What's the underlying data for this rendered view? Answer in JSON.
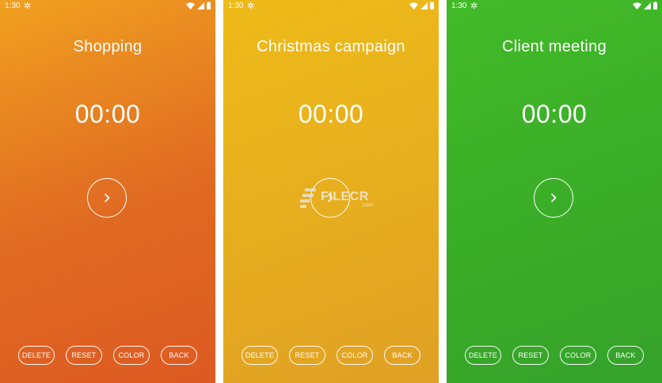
{
  "screens": [
    {
      "name": "orange",
      "gradient": [
        "#f0a020",
        "#e06a22",
        "#dd5a22"
      ],
      "status_time": "1:30",
      "title": "Shopping",
      "timer": "00:00",
      "buttons": {
        "delete": "DELETE",
        "reset": "RESET",
        "color": "COLOR",
        "back": "BACK"
      }
    },
    {
      "name": "yellow",
      "gradient": [
        "#eebb18",
        "#e6ad1f",
        "#e0a025"
      ],
      "status_time": "1:30",
      "title": "Christmas campaign",
      "timer": "00:00",
      "buttons": {
        "delete": "DELETE",
        "reset": "RESET",
        "color": "COLOR",
        "back": "BACK"
      }
    },
    {
      "name": "green",
      "gradient": [
        "#42ba28",
        "#3aad28",
        "#35a22a"
      ],
      "status_time": "1:30",
      "title": "Client meeting",
      "timer": "00:00",
      "buttons": {
        "delete": "DELETE",
        "reset": "RESET",
        "color": "COLOR",
        "back": "BACK"
      }
    }
  ],
  "watermark": {
    "text": "FILECR",
    "suffix": ".com"
  },
  "icons": {
    "status_gear": "gear-icon",
    "status_wifi": "wifi-icon",
    "status_signal": "signal-icon",
    "status_battery": "battery-icon",
    "play": "chevron-right-icon"
  }
}
